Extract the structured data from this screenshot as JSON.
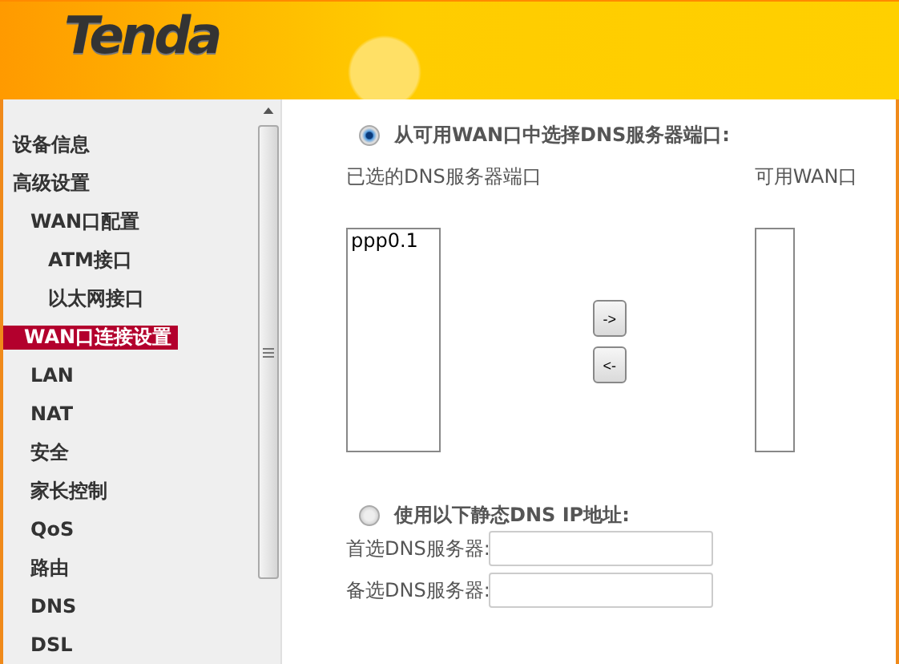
{
  "header": {
    "logo": "Tenda"
  },
  "sidebar": {
    "items": [
      {
        "label": "设备信息",
        "selected": false
      },
      {
        "label": "高级设置",
        "selected": false,
        "children": [
          {
            "label": "WAN口配置",
            "selected": false,
            "children": [
              {
                "label": "ATM接口",
                "selected": false
              },
              {
                "label": "以太网接口",
                "selected": false
              }
            ]
          },
          {
            "label": "WAN口连接设置",
            "selected": true
          },
          {
            "label": "LAN",
            "selected": false
          },
          {
            "label": "NAT",
            "selected": false
          },
          {
            "label": "安全",
            "selected": false
          },
          {
            "label": "家长控制",
            "selected": false
          },
          {
            "label": "QoS",
            "selected": false
          },
          {
            "label": "路由",
            "selected": false
          },
          {
            "label": "DNS",
            "selected": false
          },
          {
            "label": "DSL",
            "selected": false
          }
        ]
      }
    ]
  },
  "dns_from_wan": {
    "label": "从可用WAN口中选择DNS服务器端口:",
    "selected": true,
    "selected_list": {
      "label": "已选的DNS服务器端口",
      "items": [
        "ppp0.1"
      ]
    },
    "available_list": {
      "label": "可用WAN口"
    },
    "buttons": [
      "->",
      "<-"
    ]
  },
  "dns_static": {
    "label": "使用以下静态DNS IP地址:",
    "selected": false,
    "fields": [
      {
        "label": "首选DNS服务器:"
      },
      {
        "label": "备选DNS服务器:"
      }
    ]
  }
}
